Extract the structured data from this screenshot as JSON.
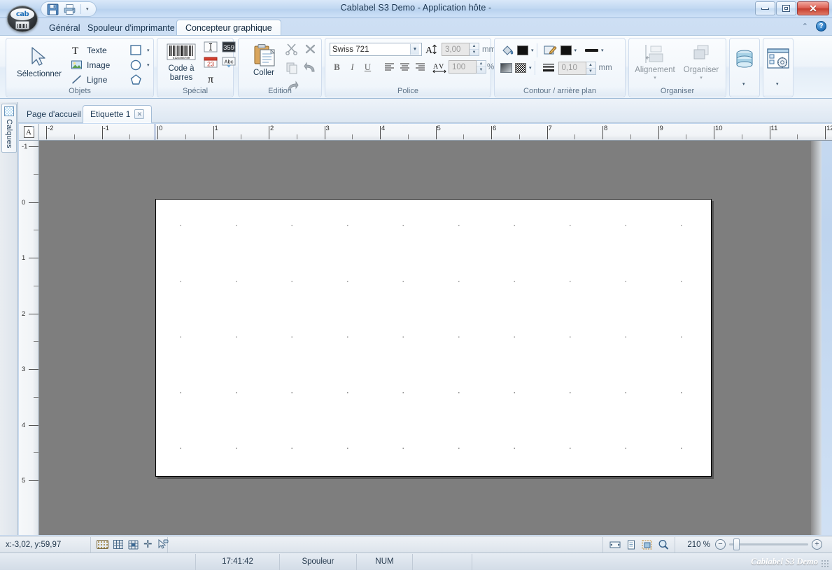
{
  "window": {
    "title": "Cablabel S3 Demo  - Application hôte -",
    "minimize": "Minimize",
    "maximize": "Restore",
    "close": "✕"
  },
  "quick_access": {
    "save": "save-icon",
    "print": "print-icon",
    "customize": "▾"
  },
  "logo": {
    "text": "cab"
  },
  "ribbon": {
    "tabs": [
      {
        "label": "Général",
        "selected": false
      },
      {
        "label": "Spouleur d'imprimante",
        "selected": false
      },
      {
        "label": "Concepteur graphique",
        "selected": true
      }
    ],
    "collapse": "⌃",
    "help": "?",
    "groups": [
      {
        "title": "Objets",
        "select_label": "Sélectionner",
        "items": [
          {
            "label": "Texte",
            "icon": "text-icon"
          },
          {
            "label": "Image",
            "icon": "image-icon"
          },
          {
            "label": "Ligne",
            "icon": "line-icon"
          }
        ],
        "shapes": [
          "rectangle-icon",
          "ellipse-icon",
          "polygon-icon"
        ]
      },
      {
        "title": "Spécial",
        "barcode_label": "Code à barres",
        "icons": [
          "text-field-icon",
          "counter-icon",
          "date-icon",
          "abc-icon",
          "pi-icon"
        ],
        "counter_text": "359",
        "date_text": "23",
        "abc_text": "Abc",
        "pi_text": "π"
      },
      {
        "title": "Edition",
        "paste_label": "Coller",
        "icons": [
          "cut-icon",
          "delete-icon",
          "copy-icon",
          "undo-icon",
          "redo-icon"
        ]
      },
      {
        "title": "Police",
        "font_name": "Swiss 721",
        "font_size": "3,00",
        "font_size_unit": "mm",
        "char_spacing": "100",
        "char_spacing_unit": "%",
        "bold": "B",
        "italic": "I",
        "underline": "U",
        "align_left": "align-left-icon",
        "align_center": "align-center-icon",
        "align_right": "align-right-icon"
      },
      {
        "title": "Contour / arrière plan",
        "line_width": "0,10",
        "line_width_unit": "mm",
        "icons": [
          "fill-color-icon",
          "fill-pattern-icon",
          "pen-color-icon",
          "line-style-icon",
          "line-weight-icon"
        ]
      },
      {
        "title": "Organiser",
        "align_label": "Alignement",
        "arrange_label": "Organiser",
        "dropdown": "▾"
      },
      {
        "title": "",
        "icons": [
          "database-icon",
          "settings-window-icon"
        ],
        "dropdown": "▾"
      }
    ]
  },
  "document_tabs": [
    {
      "label": "Page d'accueil",
      "selected": false,
      "closable": false
    },
    {
      "label": "Etiquette 1",
      "selected": true,
      "closable": true,
      "close_glyph": "✕"
    }
  ],
  "left_panel": {
    "tab_label": "Calques",
    "tab_icon": "layers-icon"
  },
  "rulers": {
    "unit": "mm",
    "h_labels": [
      "-2",
      "-1",
      "0",
      "1",
      "2",
      "3",
      "4",
      "5",
      "6",
      "7",
      "8",
      "9",
      "10",
      "11",
      "12"
    ],
    "v_labels": [
      "-1",
      "0",
      "1",
      "2",
      "3",
      "4",
      "5"
    ],
    "corner_icon": "ruler-origin-icon"
  },
  "status_bar": {
    "coordinates": "x:-3,02, y:59,97",
    "tools": [
      "grid-dots-icon",
      "grid-lines-icon",
      "grid-snap-icon",
      "crosshair-icon",
      "select-link-icon"
    ],
    "view_icons": [
      "fit-width-icon",
      "fit-page-icon",
      "fit-selection-icon",
      "zoom-icon"
    ],
    "zoom_level": "210 %",
    "zoom_out": "−",
    "zoom_in": "+"
  },
  "status_bar2": {
    "time": "17:41:42",
    "spooler": "Spouleur",
    "num_lock": "NUM",
    "brand": "Cablabel S3 Demo"
  }
}
